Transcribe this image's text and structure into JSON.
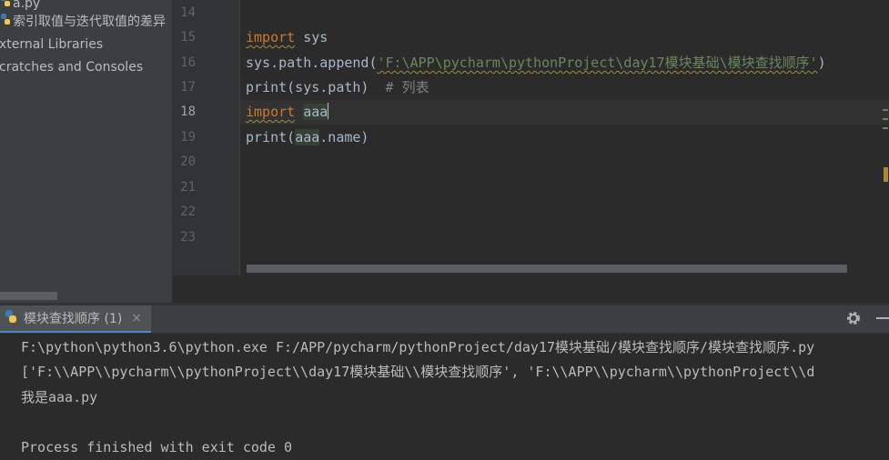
{
  "sidebar": {
    "items": [
      {
        "label": "a.py",
        "icon": "python-file-icon"
      },
      {
        "label": "索引取值与迭代取值的差异",
        "icon": "python-file-icon"
      },
      {
        "label": "xternal Libraries",
        "icon": ""
      },
      {
        "label": "cratches and Consoles",
        "icon": ""
      }
    ]
  },
  "editor": {
    "line_numbers": [
      "14",
      "15",
      "16",
      "17",
      "18",
      "19",
      "20",
      "21",
      "22",
      "23"
    ],
    "current_line": "18",
    "lines": {
      "l15_kw": "import",
      "l15_rest": " sys",
      "l16_pre": "sys.path.append(",
      "l16_str": "'F:\\APP\\pycharm\\pythonProject\\day17模块基础\\模块查找顺序'",
      "l16_post": ")",
      "l17_code": "print(sys.path)",
      "l17_comment": "# 列表",
      "l18_kw": "import",
      "l18_ident": "aaa",
      "l19_pre": "print(",
      "l19_ident": "aaa",
      "l19_post": ".name)"
    }
  },
  "run_panel": {
    "tab_label": "模块查找顺序 (1)",
    "tab_close": "×",
    "output": [
      "F:\\python\\python3.6\\python.exe F:/APP/pycharm/pythonProject/day17模块基础/模块查找顺序/模块查找顺序.py",
      "['F:\\\\APP\\\\pycharm\\\\pythonProject\\\\day17模块基础\\\\模块查找顺序', 'F:\\\\APP\\\\pycharm\\\\pythonProject\\\\d",
      "我是aaa.py",
      "",
      "Process finished with exit code 0"
    ]
  },
  "colors": {
    "keyword": "#cc7832",
    "string": "#6a8759",
    "comment": "#808080",
    "text": "#a9b7c6",
    "background": "#2b2b2b"
  }
}
